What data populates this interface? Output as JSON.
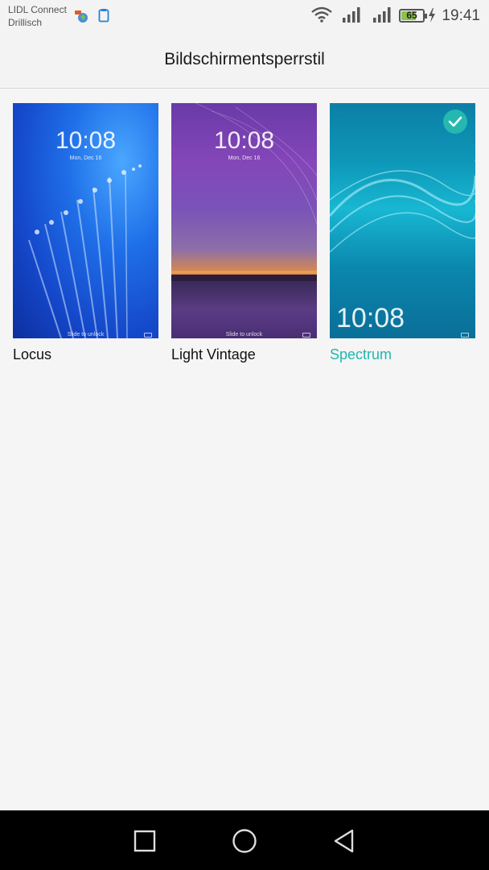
{
  "status_bar": {
    "carrier_line1": "LIDL Connect",
    "carrier_line2": "Drillisch",
    "battery_percent": "65",
    "time": "19:41",
    "icons": [
      "notification-app-icon",
      "clipboard-icon",
      "wifi-icon",
      "signal-icon",
      "signal-icon",
      "battery-icon",
      "charging-icon"
    ]
  },
  "app_bar": {
    "title": "Bildschirmentsperrstil"
  },
  "themes": [
    {
      "name": "Locus",
      "preview_time": "10:08",
      "preview_date": "Mon, Dec 16",
      "preview_unlock": "Slide to unlock",
      "selected": false
    },
    {
      "name": "Light Vintage",
      "preview_time": "10:08",
      "preview_date": "Mon, Dec 16",
      "preview_unlock": "Slide to unlock",
      "selected": false
    },
    {
      "name": "Spectrum",
      "preview_time": "10:08",
      "selected": true
    }
  ],
  "nav_bar": {
    "buttons": [
      "recents-icon",
      "home-icon",
      "back-icon"
    ]
  },
  "colors": {
    "accent": "#1fb7b0",
    "background": "#f5f5f5",
    "navbar": "#000000"
  }
}
